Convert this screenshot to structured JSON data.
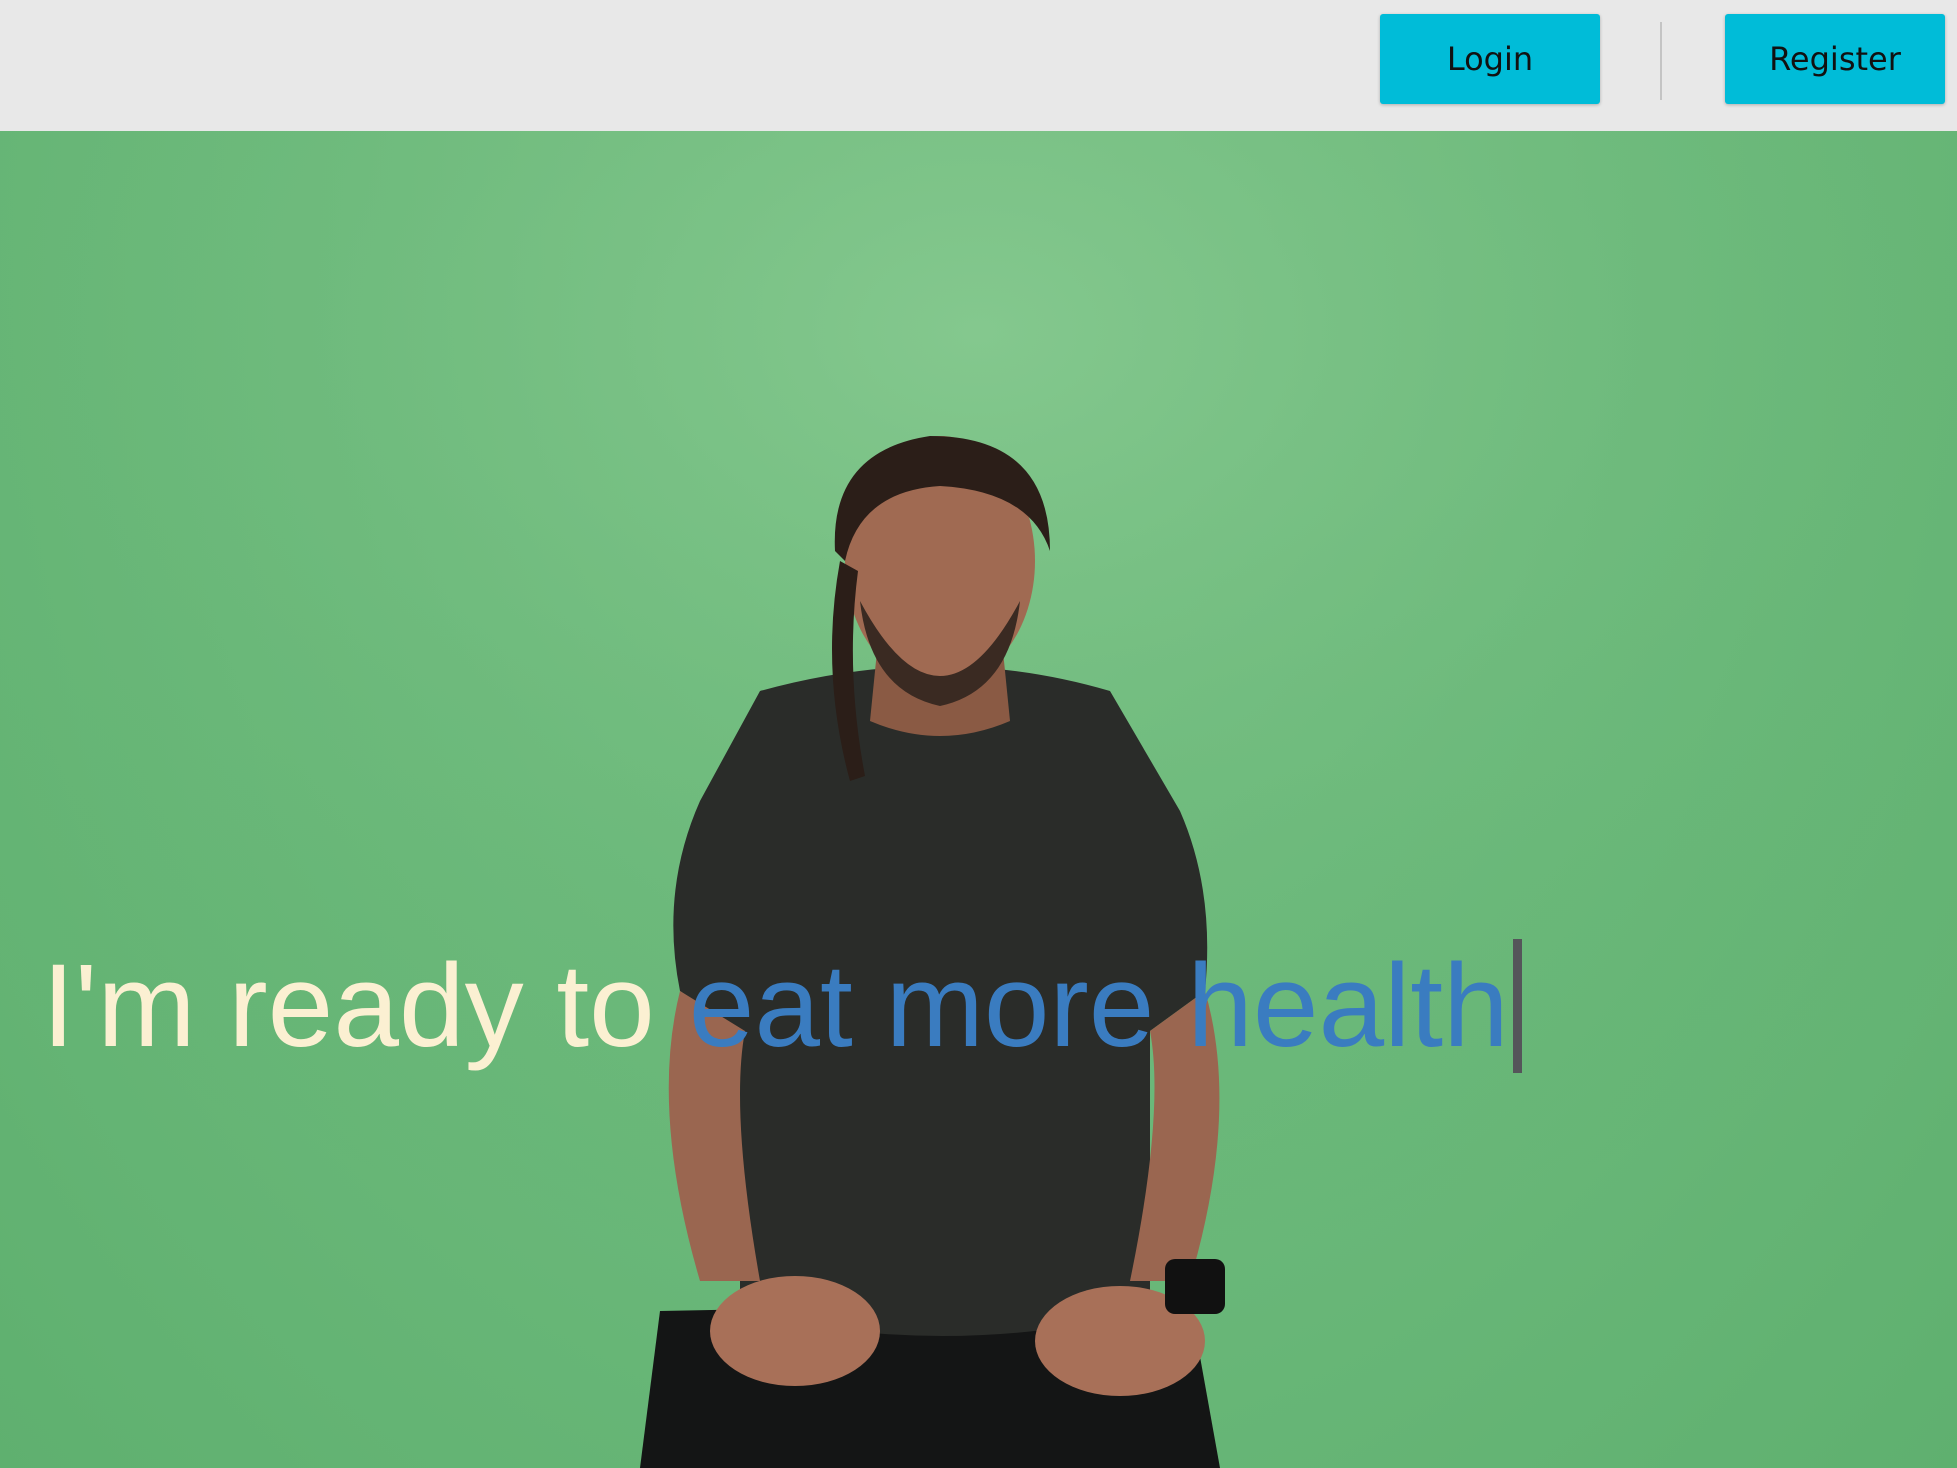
{
  "header": {
    "login_label": "Login",
    "register_label": "Register"
  },
  "hero": {
    "static_text": "I'm ready to",
    "typed_text": "eat more health"
  },
  "colors": {
    "header_bg": "#e8e8e8",
    "button": "#00bcd8",
    "hero_green": "#6dba7c",
    "static_text": "#fbf0d2",
    "typed_text": "#3a7cc0"
  }
}
